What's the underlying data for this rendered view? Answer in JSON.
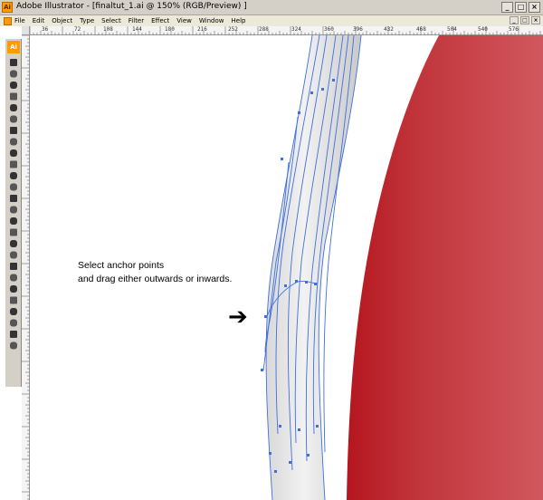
{
  "window": {
    "title": "Adobe Illustrator - [finaltut_1.ai @ 150% (RGB/Preview) ]",
    "app_icon": "illustrator-icon",
    "controls": [
      "_",
      "□",
      "×"
    ],
    "doc_controls": [
      "_",
      "□",
      "×"
    ]
  },
  "menubar": {
    "items": [
      "File",
      "Edit",
      "Object",
      "Type",
      "Select",
      "Filter",
      "Effect",
      "View",
      "Window",
      "Help"
    ]
  },
  "toolbox": {
    "logo": "Ai",
    "tools": [
      "selection-tool-icon",
      "direct-selection-tool-icon",
      "magic-wand-tool-icon",
      "lasso-tool-icon",
      "pen-tool-icon",
      "type-tool-icon",
      "line-segment-tool-icon",
      "ellipse-tool-icon",
      "paintbrush-tool-icon",
      "pencil-tool-icon",
      "rotate-tool-icon",
      "scale-tool-icon",
      "warp-tool-icon",
      "free-transform-tool-icon",
      "symbol-sprayer-tool-icon",
      "column-graph-tool-icon",
      "mesh-tool-icon",
      "gradient-tool-icon",
      "eyedropper-tool-icon",
      "blend-tool-icon",
      "live-paint-bucket-tool-icon",
      "crop-area-tool-icon",
      "slice-tool-icon",
      "eraser-tool-icon",
      "hand-tool-icon",
      "zoom-tool-icon"
    ]
  },
  "rulers": {
    "top_labels": [
      "36",
      "72",
      "108",
      "144",
      "180",
      "216",
      "252",
      "288",
      "324",
      "360",
      "396",
      "432",
      "468",
      "504",
      "540",
      "576"
    ]
  },
  "annotation": {
    "line1": "Select anchor points",
    "line2": "and drag either outwards or inwards.",
    "arrow": "➔"
  },
  "colors": {
    "red_dark": "#b5161f",
    "red_light": "#d1585e",
    "path_blue": "#3f6fe0",
    "gray_stroke": "#e6e6e6"
  }
}
